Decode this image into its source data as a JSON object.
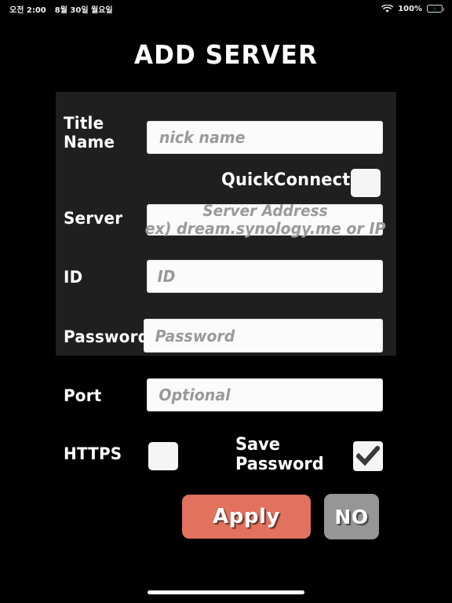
{
  "statusbar": {
    "time": "오전 2:00",
    "date": "8월 30일 월요일",
    "wifi_icon": "wifi-icon",
    "battery_percent": "100%",
    "battery_icon": "battery-charging-icon"
  },
  "header": {
    "title": "ADD SERVER"
  },
  "form": {
    "title_name": {
      "label": "Title\nName",
      "placeholder": "nick name",
      "value": ""
    },
    "quickconnect": {
      "label": "QuickConnect",
      "checked": false
    },
    "server": {
      "label": "Server",
      "placeholder_line1": "Server Address",
      "placeholder_line2": "ex) dream.synology.me or  IP",
      "value": ""
    },
    "id": {
      "label": "ID",
      "placeholder": "ID",
      "value": ""
    },
    "password": {
      "label": "Password",
      "placeholder": "Password",
      "value": ""
    },
    "port": {
      "label": "Port",
      "placeholder": "Optional",
      "value": ""
    },
    "https": {
      "label": "HTTPS",
      "checked": false
    },
    "save_password": {
      "label": "Save\nPassword",
      "checked": true,
      "check_glyph": "✔"
    }
  },
  "actions": {
    "apply_label": "Apply",
    "no_label": "NO"
  },
  "colors": {
    "background": "#000000",
    "panel": "#1f1f1f",
    "apply_button": "#e2715e",
    "no_button": "#969696",
    "field_background": "#fbfbfb",
    "placeholder_text": "#9a9a9a",
    "battery_green": "#4cd462"
  }
}
